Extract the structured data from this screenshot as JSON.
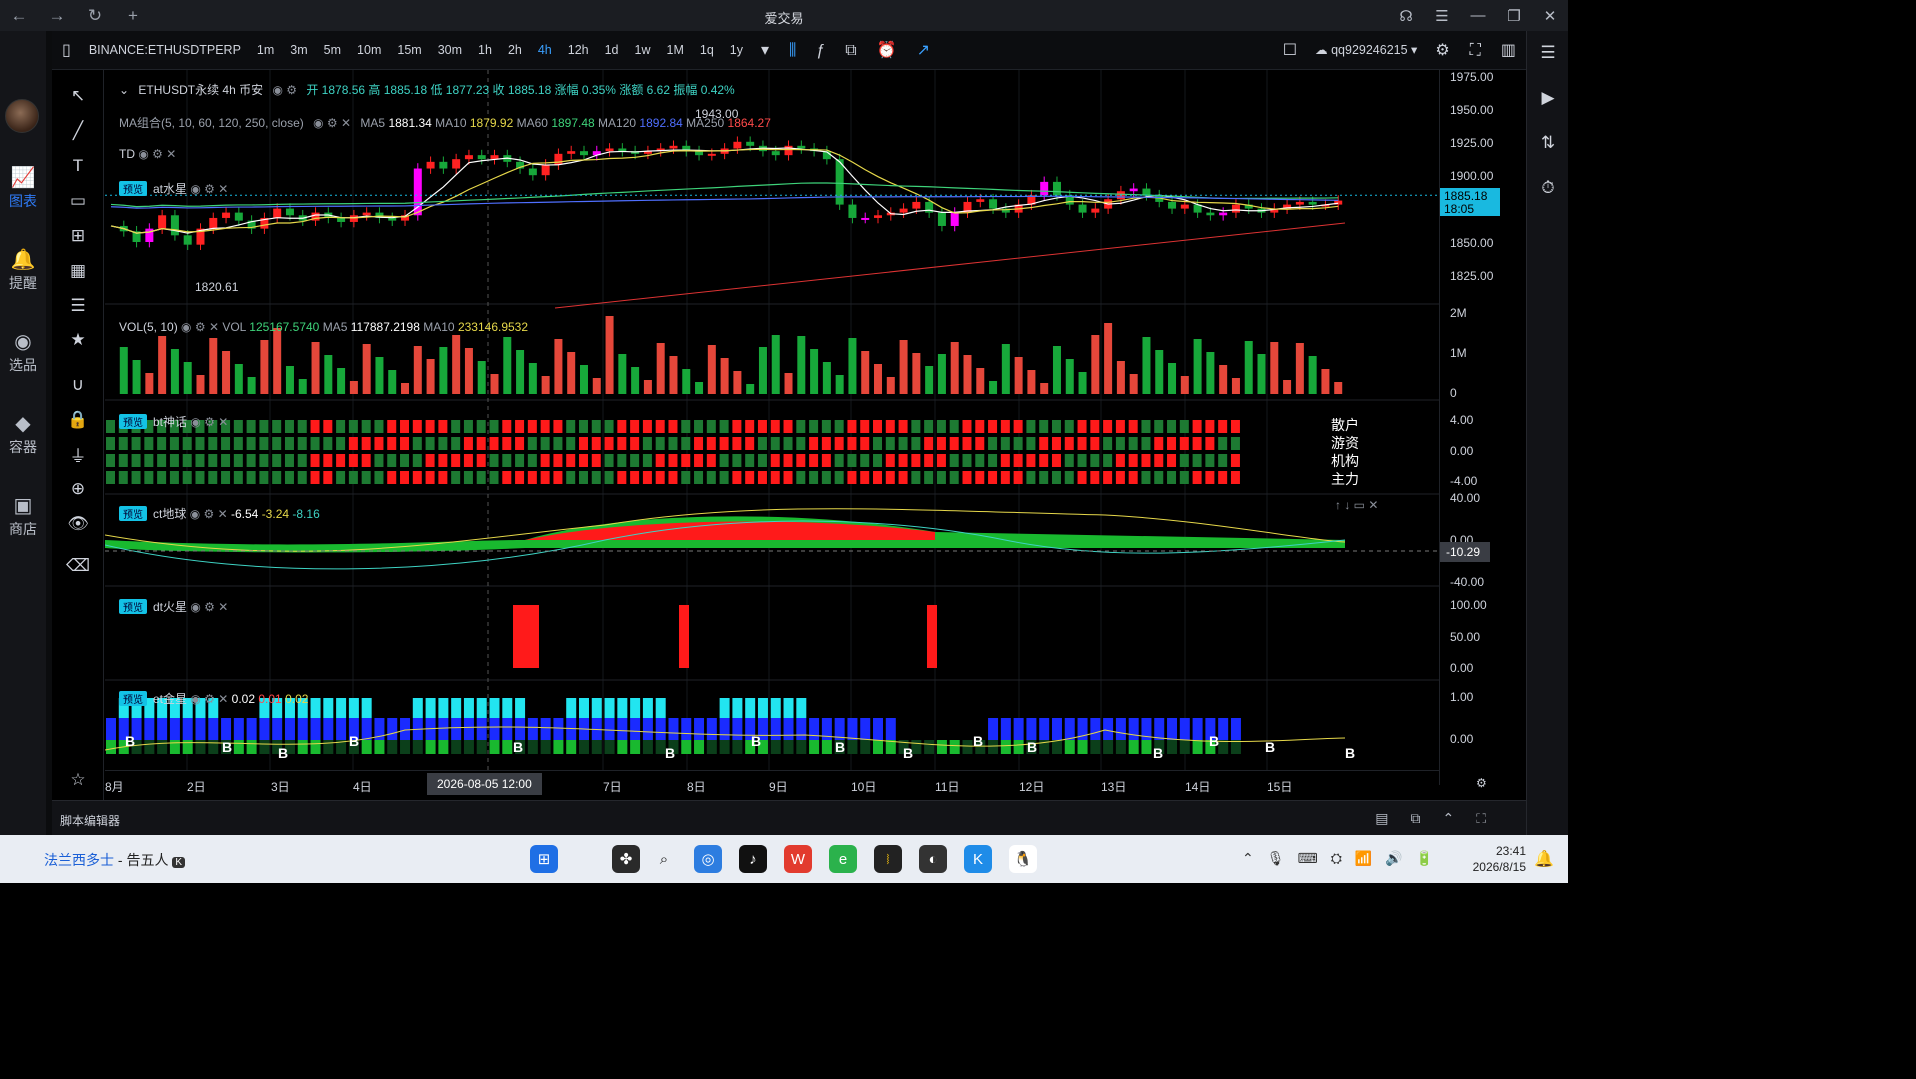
{
  "titlebar": {
    "title": "爱交易",
    "back": "←",
    "forward": "→",
    "reload": "↻",
    "newtab": "+"
  },
  "leftnav": [
    {
      "icon": "chart-icon",
      "label": "图表",
      "active": true
    },
    {
      "icon": "bell-icon",
      "label": "提醒"
    },
    {
      "icon": "screener-icon",
      "label": "选品"
    },
    {
      "icon": "container-icon",
      "label": "容器"
    },
    {
      "icon": "store-icon",
      "label": "商店"
    }
  ],
  "toolbar": {
    "symbol": "BINANCE:ETHUSDTPERP",
    "timeframes": [
      "1m",
      "3m",
      "5m",
      "10m",
      "15m",
      "30m",
      "1h",
      "2h",
      "4h",
      "12h",
      "1d",
      "1w",
      "1M",
      "1q",
      "1y"
    ],
    "active": "4h",
    "user": "qq929246215"
  },
  "legend": {
    "symbol_line": {
      "name": "ETHUSDT永续 4h 币安",
      "open": "开 1878.56",
      "high": "高 1885.18",
      "low": "低 1877.23",
      "close": "收 1885.18",
      "chg": "涨幅 0.35%",
      "chgv": "涨额 6.62",
      "amp": "振幅 0.42%"
    },
    "ma": {
      "label": "MA组合(5, 10, 60, 120, 250, close)",
      "ma5": "MA5",
      "ma5v": "1881.34",
      "ma10": "MA10",
      "ma10v": "1879.92",
      "ma60": "MA60",
      "ma60v": "1897.48",
      "ma120": "MA120",
      "ma120v": "1892.84",
      "ma250": "MA250",
      "ma250v": "1864.27"
    },
    "td": "TD",
    "at": "at水星",
    "preview": "预览"
  },
  "vol": {
    "label": "VOL(5, 10)",
    "vol": "VOL",
    "volv": "125167.5740",
    "ma5": "MA5",
    "ma5v": "117887.2198",
    "ma10": "MA10",
    "ma10v": "233146.9532"
  },
  "bt": {
    "label": "bt神话",
    "rows": [
      "散户",
      "游资",
      "机构",
      "主力"
    ]
  },
  "ct": {
    "label": "ct地球",
    "v1": "-6.54",
    "v2": "-3.24",
    "v3": "-8.16"
  },
  "dt": {
    "label": "dt火星"
  },
  "et": {
    "label": "et金星",
    "v1": "0.02",
    "v2": "0.01",
    "v3": "0.02"
  },
  "price_annot": {
    "low": "1820.61",
    "high": "1943.00"
  },
  "price_axis": [
    "1975.00",
    "1950.00",
    "1925.00",
    "1900.00",
    "1850.00",
    "1825.00"
  ],
  "last_price": "1885.18",
  "countdown": "18:05",
  "vol_axis": [
    "2M",
    "1M",
    "0"
  ],
  "bt_axis": [
    "4.00",
    "0.00",
    "-4.00"
  ],
  "ct_axis": [
    "40.00",
    "0.00",
    "-40.00"
  ],
  "ct_last": "-10.29",
  "dt_axis": [
    "100.00",
    "50.00",
    "0.00"
  ],
  "et_axis": [
    "1.00",
    "0.00"
  ],
  "time_axis": [
    "8月",
    "2日",
    "3日",
    "4日",
    "7日",
    "8日",
    "9日",
    "10日",
    "11日",
    "12日",
    "13日",
    "14日",
    "15日"
  ],
  "crosshair_time": "2026-08-05   12:00",
  "footer": "脚本编辑器",
  "taskbar": {
    "song": "法兰西多士",
    "artist": "- 告五人",
    "time": "23:41",
    "date": "2026/8/15"
  },
  "chart_data": {
    "type": "candlestick",
    "interval": "4h",
    "last": {
      "open": 1878.56,
      "high": 1885.18,
      "low": 1877.23,
      "close": 1885.18
    },
    "ylim": [
      1800,
      1975
    ]
  }
}
